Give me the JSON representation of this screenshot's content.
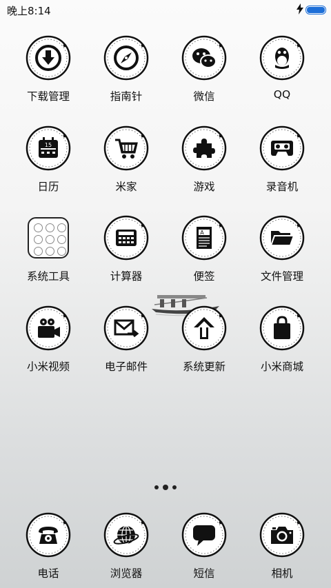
{
  "status": {
    "time": "晚上8:14",
    "battery_color": "#1d6fd8"
  },
  "grid": [
    {
      "label": "下载管理",
      "icon": "download-icon"
    },
    {
      "label": "指南针",
      "icon": "compass-icon"
    },
    {
      "label": "微信",
      "icon": "wechat-icon"
    },
    {
      "label": "QQ",
      "icon": "qq-penguin-icon"
    },
    {
      "label": "日历",
      "icon": "calendar-icon",
      "day": "15"
    },
    {
      "label": "米家",
      "icon": "shopping-cart-icon"
    },
    {
      "label": "游戏",
      "icon": "puzzle-icon"
    },
    {
      "label": "录音机",
      "icon": "cassette-icon"
    },
    {
      "label": "系统工具",
      "icon": "tools-folder-icon"
    },
    {
      "label": "计算器",
      "icon": "calculator-icon"
    },
    {
      "label": "便签",
      "icon": "notes-icon"
    },
    {
      "label": "文件管理",
      "icon": "folder-icon"
    },
    {
      "label": "小米视频",
      "icon": "video-camera-icon"
    },
    {
      "label": "电子邮件",
      "icon": "mail-icon"
    },
    {
      "label": "系统更新",
      "icon": "update-arrow-icon"
    },
    {
      "label": "小米商城",
      "icon": "shopping-bag-icon"
    }
  ],
  "page_indicator": {
    "count": 3,
    "current": 2
  },
  "dock": [
    {
      "label": "电话",
      "icon": "telephone-icon"
    },
    {
      "label": "浏览器",
      "icon": "globe-icon"
    },
    {
      "label": "短信",
      "icon": "message-bubble-icon"
    },
    {
      "label": "相机",
      "icon": "camera-icon"
    }
  ]
}
